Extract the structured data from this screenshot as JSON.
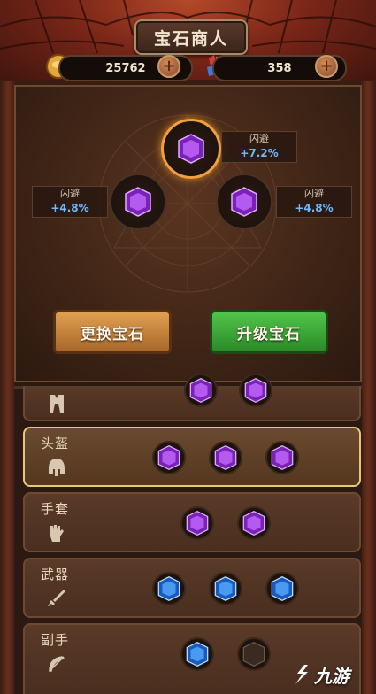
{
  "header": {
    "title": "宝石商人"
  },
  "resources": {
    "coins": "25762",
    "gems": "358"
  },
  "center": {
    "top_stat": {
      "name": "闪避",
      "value": "+7.2%"
    },
    "left_stat": {
      "name": "闪避",
      "value": "+4.8%"
    },
    "right_stat": {
      "name": "闪避",
      "value": "+4.8%"
    }
  },
  "buttons": {
    "change": "更换宝石",
    "upgrade": "升级宝石"
  },
  "equipment": [
    {
      "label": "头盔",
      "gems": [
        "purple",
        "purple",
        "purple"
      ]
    },
    {
      "label": "手套",
      "gems": [
        "purple",
        "purple"
      ]
    },
    {
      "label": "武器",
      "gems": [
        "blue",
        "blue",
        "blue"
      ]
    },
    {
      "label": "副手",
      "gems": [
        "blue",
        "dark"
      ]
    }
  ],
  "colors": {
    "purple_gem": "#9b3cd8",
    "blue_gem": "#2f7fe6",
    "accent_gold": "#f0a040",
    "green_button": "#3aa838"
  },
  "watermark": {
    "text": "九游"
  }
}
